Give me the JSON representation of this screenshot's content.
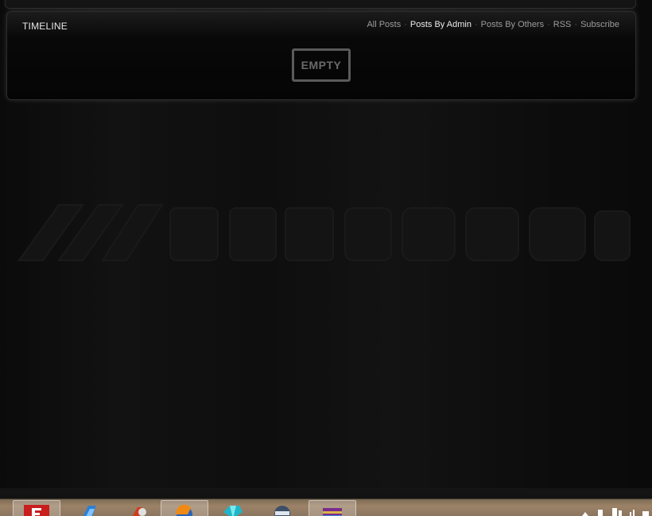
{
  "timeline": {
    "title": "TIMELINE",
    "filters": [
      {
        "label": "All Posts",
        "active": false
      },
      {
        "label": "Posts By Admin",
        "active": true
      },
      {
        "label": "Posts By Others",
        "active": false
      },
      {
        "label": "RSS",
        "active": false
      },
      {
        "label": "Subscribe",
        "active": false
      }
    ],
    "empty_label": "EMPTY"
  },
  "taskbar": {
    "apps": [
      {
        "icon": "flash-app-icon",
        "pressed": true
      },
      {
        "icon": "media-app-icon",
        "pressed": false
      },
      {
        "icon": "red-app-icon",
        "pressed": false
      },
      {
        "icon": "firefox-icon",
        "pressed": true
      },
      {
        "icon": "diamond-app-icon",
        "pressed": false
      },
      {
        "icon": "disc-app-icon",
        "pressed": false
      },
      {
        "icon": "winrar-icon",
        "pressed": true
      }
    ]
  },
  "colors": {
    "background": "#0c0c0c",
    "panel": "#050505",
    "active_link": "#ececec",
    "link": "#9c9c9c",
    "empty_border": "#5a5a5a"
  }
}
